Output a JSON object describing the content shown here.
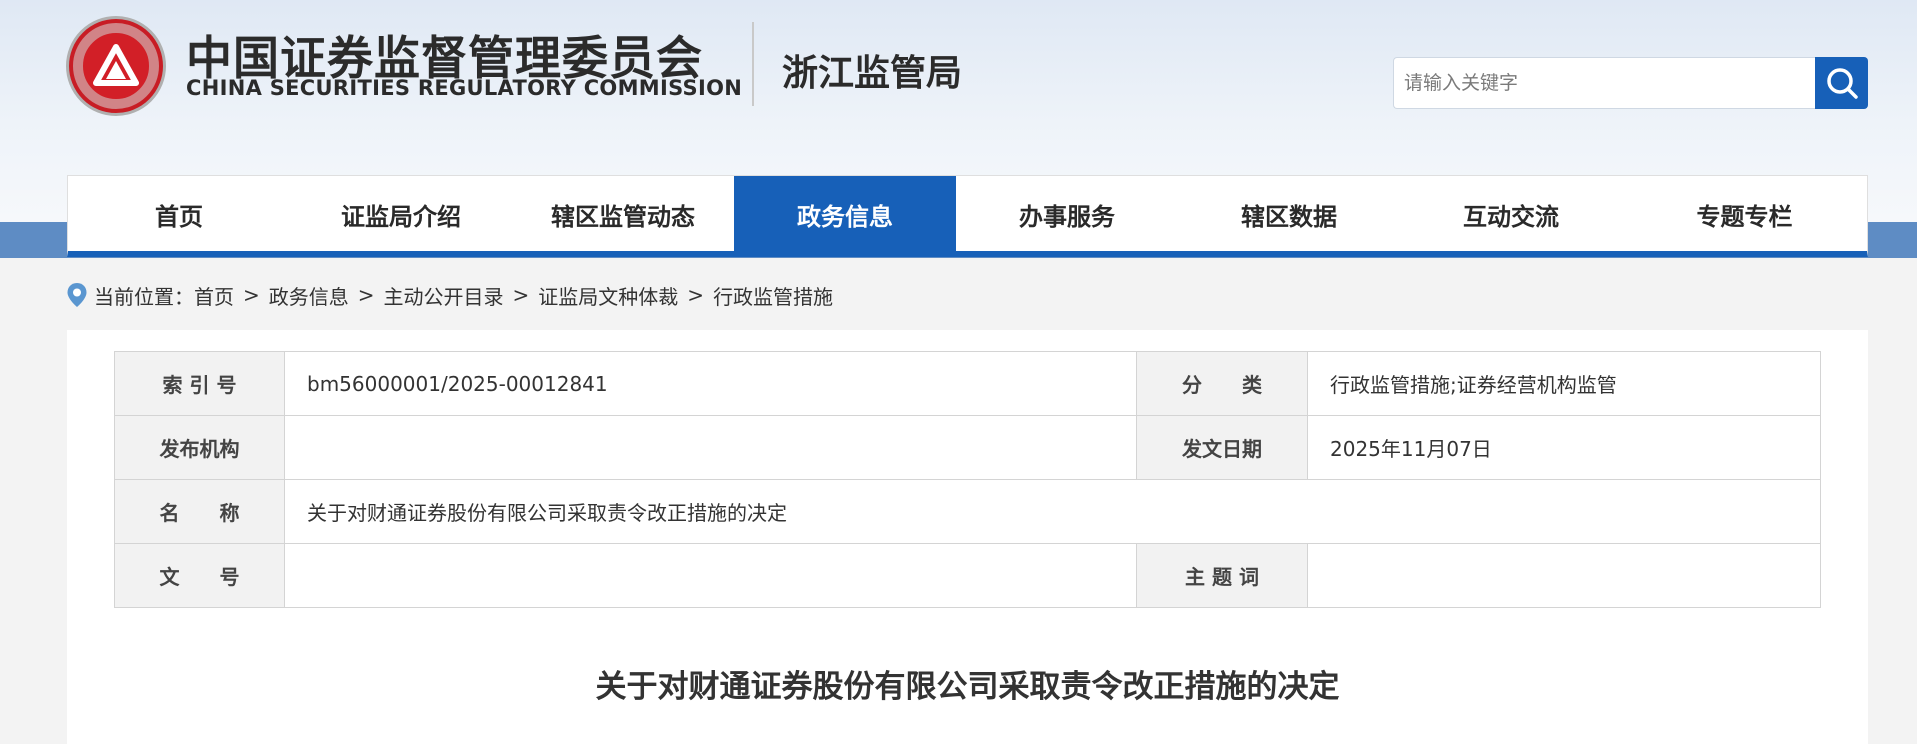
{
  "header": {
    "logo_cn": "中国证券监督管理委员会",
    "logo_en": "CHINA SECURITIES REGULATORY COMMISSION",
    "bureau": "浙江监管局",
    "search_placeholder": "请输入关键字",
    "search_icon": "search-icon"
  },
  "nav": {
    "items": [
      {
        "label": "首页",
        "active": false
      },
      {
        "label": "证监局介绍",
        "active": false
      },
      {
        "label": "辖区监管动态",
        "active": false
      },
      {
        "label": "政务信息",
        "active": true
      },
      {
        "label": "办事服务",
        "active": false
      },
      {
        "label": "辖区数据",
        "active": false
      },
      {
        "label": "互动交流",
        "active": false
      },
      {
        "label": "专题专栏",
        "active": false
      }
    ]
  },
  "breadcrumb": {
    "prefix": "当前位置：",
    "separator": ">",
    "items": [
      "首页",
      "政务信息",
      "主动公开目录",
      "证监局文种体裁",
      "行政监管措施"
    ]
  },
  "meta": {
    "index_label": "索 引 号",
    "index_value": "bm56000001/2025-00012841",
    "category_label": "分　　类",
    "category_value": "行政监管措施;证券经营机构监管",
    "publisher_label": "发布机构",
    "publisher_value": "",
    "date_label": "发文日期",
    "date_value": "2025年11月07日",
    "name_label": "名　　称",
    "name_value": "关于对财通证券股份有限公司采取责令改正措施的决定",
    "docno_label": "文　　号",
    "docno_value": "",
    "keyword_label": "主 题 词",
    "keyword_value": ""
  },
  "document": {
    "title": "关于对财通证券股份有限公司采取责令改正措施的决定"
  },
  "colors": {
    "primary_blue": "#1760b8",
    "band_blue": "#5e8cc4",
    "logo_red": "#d21f27"
  }
}
